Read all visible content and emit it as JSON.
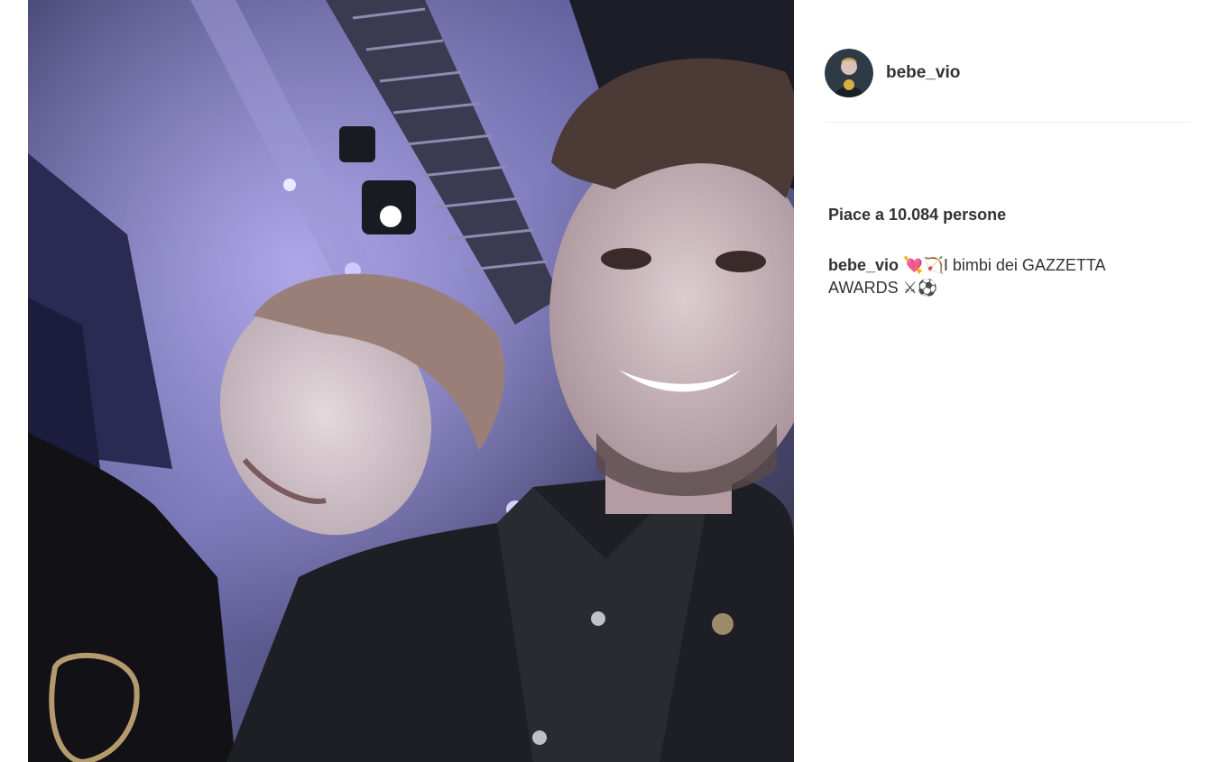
{
  "post": {
    "photo": {
      "description_icon": "photo-image"
    },
    "header": {
      "username": "bebe_vio",
      "avatar_icon": "avatar-icon"
    },
    "likes_text": "Piace a 10.084 persone",
    "caption": {
      "username": "bebe_vio",
      "text": " 💘🏹I bimbi dei GAZZETTA AWARDS ⚔⚽"
    }
  }
}
